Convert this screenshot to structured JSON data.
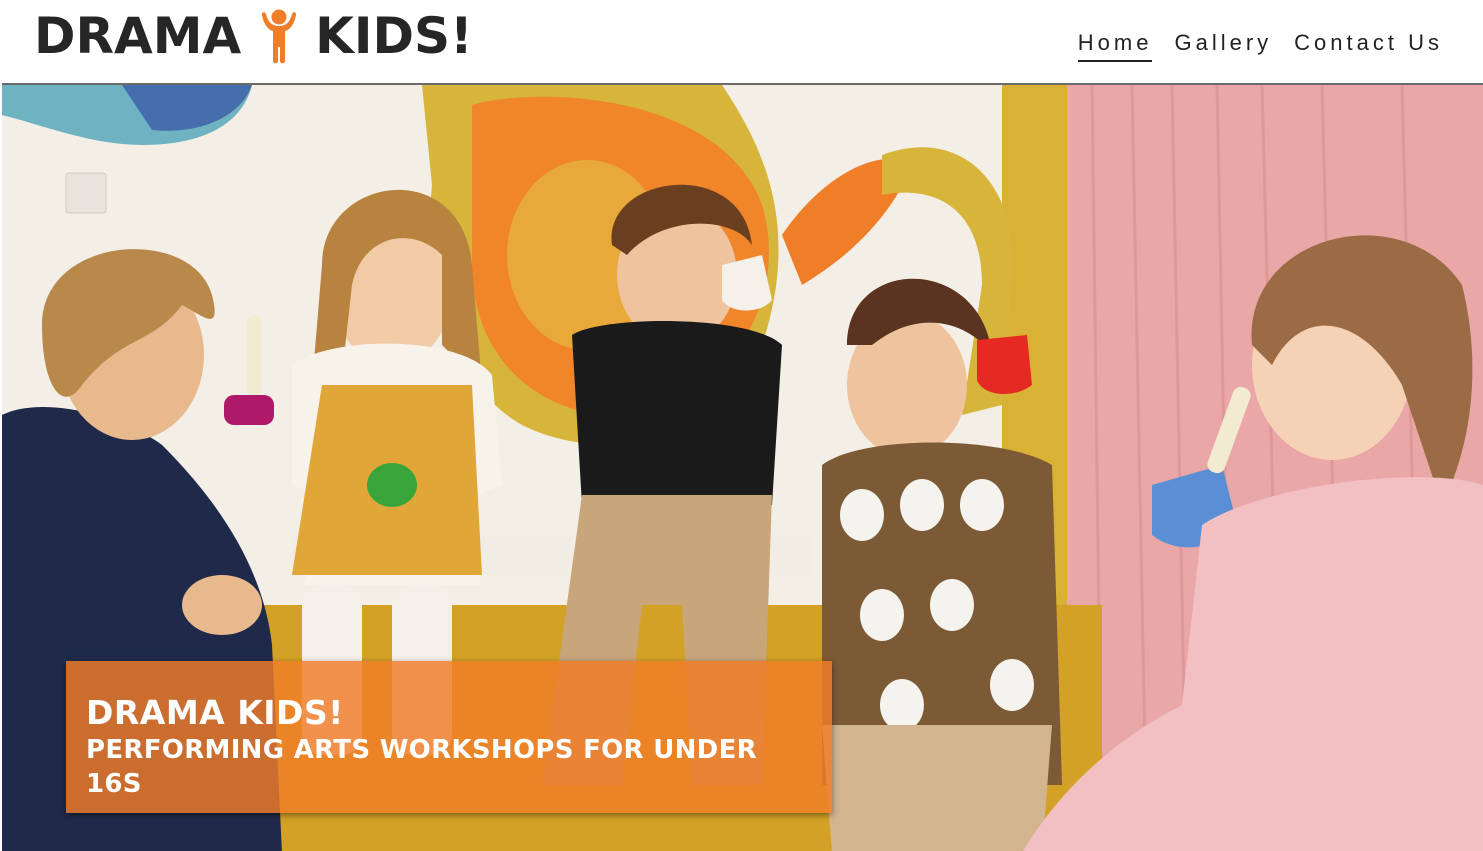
{
  "header": {
    "logo_left": "DRAMA",
    "logo_right": "KIDS!",
    "logo_icon": "person-arms-up-icon",
    "brand_color": "#f07d28"
  },
  "nav": {
    "items": [
      {
        "label": "Home",
        "active": true
      },
      {
        "label": "Gallery",
        "active": false
      },
      {
        "label": "Contact Us",
        "active": false
      }
    ]
  },
  "hero": {
    "image": "children-playing-handbells-photo",
    "banner_title": "DRAMA KIDS!",
    "banner_subtitle": "PERFORMING ARTS WORKSHOPS FOR UNDER 16S",
    "banner_color": "#f07d28"
  }
}
